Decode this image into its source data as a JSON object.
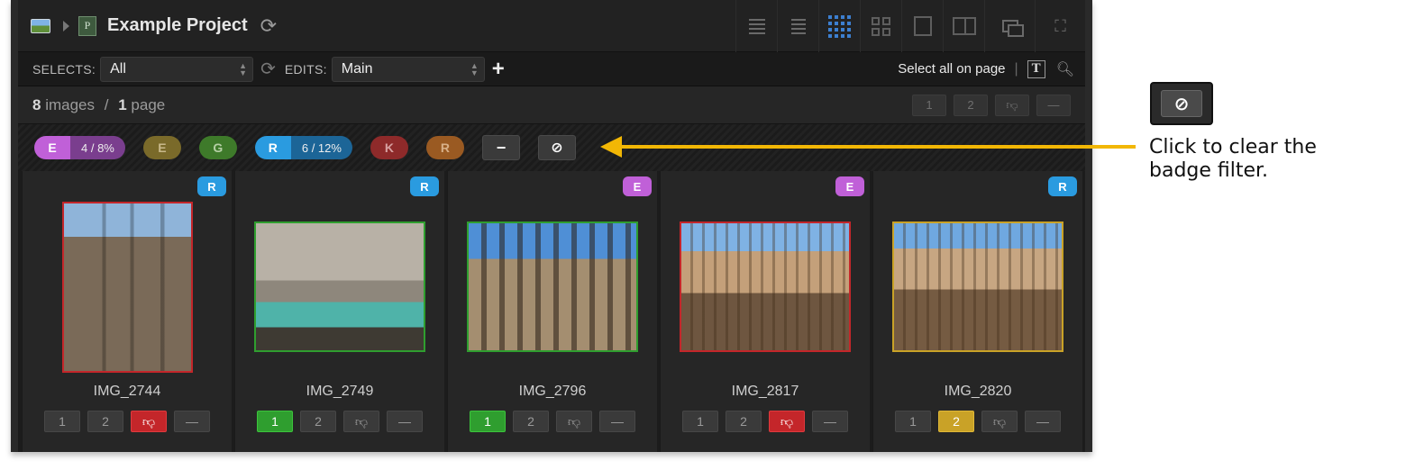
{
  "header": {
    "project_initial": "P",
    "project_title": "Example Project"
  },
  "toolbar": {
    "selects_label": "SELECTS:",
    "selects_value": "All",
    "edits_label": "EDITS:",
    "edits_value": "Main",
    "add_label": "+",
    "select_all_label": "Select all on page",
    "text_tool_label": "T"
  },
  "counts": {
    "images_count": "8",
    "images_label": "images",
    "slash": "/",
    "pages_count": "1",
    "pages_label": "page",
    "filter_buttons": [
      "1",
      "2"
    ]
  },
  "badges": [
    {
      "letter": "E",
      "stat": "4 / 8%",
      "color": "#c060d8",
      "stat_color": "#7a3e8e"
    },
    {
      "letter": "E",
      "stat": "",
      "color": "#7a6a2a"
    },
    {
      "letter": "G",
      "stat": "",
      "color": "#3e7a2a"
    },
    {
      "letter": "R",
      "stat": "6 / 12%",
      "color": "#2a9be0",
      "stat_color": "#1c6597"
    },
    {
      "letter": "K",
      "stat": "",
      "color": "#8e2a2a"
    },
    {
      "letter": "R",
      "stat": "",
      "color": "#9a5a22"
    }
  ],
  "images": [
    {
      "name": "IMG_2744",
      "badge": "R",
      "badge_color": "#2a9be0",
      "border": "#c4262a",
      "rating": "reject"
    },
    {
      "name": "IMG_2749",
      "badge": "R",
      "badge_color": "#2a9be0",
      "border": "#2f9e2f",
      "rating": "1"
    },
    {
      "name": "IMG_2796",
      "badge": "E",
      "badge_color": "#c060d8",
      "border": "#2f9e2f",
      "rating": "1"
    },
    {
      "name": "IMG_2817",
      "badge": "E",
      "badge_color": "#c060d8",
      "border": "#c4262a",
      "rating": "reject"
    },
    {
      "name": "IMG_2820",
      "badge": "R",
      "badge_color": "#2a9be0",
      "border": "#c9a227",
      "rating": "2"
    }
  ],
  "action_labels": {
    "one": "1",
    "two": "2"
  },
  "annotation": {
    "text": "Click to clear the badge filter.",
    "arrow_color": "#f2b705"
  }
}
